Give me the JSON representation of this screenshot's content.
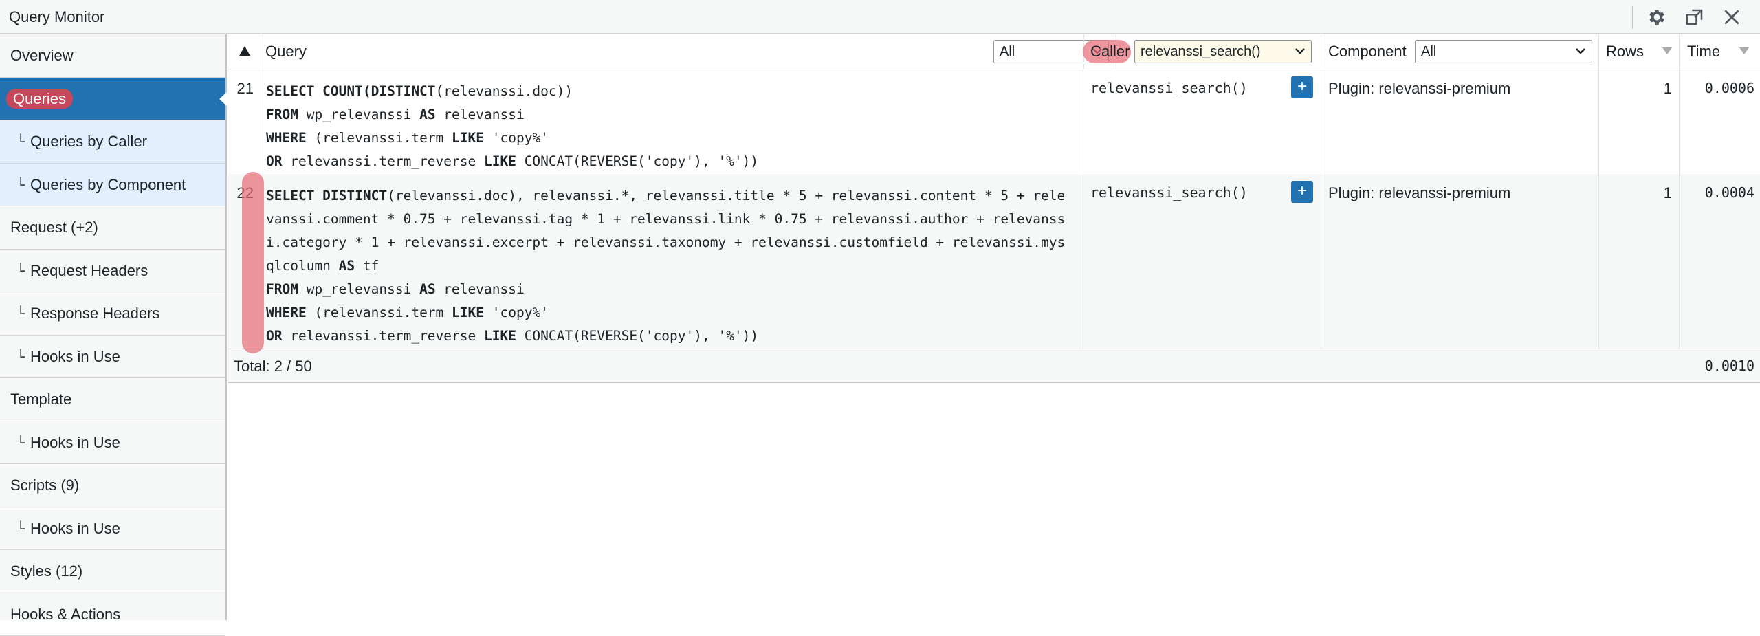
{
  "window": {
    "title": "Query Monitor",
    "icons": [
      "gear-icon",
      "popout-icon",
      "close-icon"
    ]
  },
  "sidebar": {
    "items": [
      {
        "label": "Overview"
      },
      {
        "label": "Queries"
      },
      {
        "label": "Queries by Caller"
      },
      {
        "label": "Queries by Component"
      },
      {
        "label": "Request (+2)"
      },
      {
        "label": "Request Headers"
      },
      {
        "label": "Response Headers"
      },
      {
        "label": "Hooks in Use"
      },
      {
        "label": "Template"
      },
      {
        "label": "Hooks in Use"
      },
      {
        "label": "Scripts (9)"
      },
      {
        "label": "Hooks in Use"
      },
      {
        "label": "Styles (12)"
      },
      {
        "label": "Hooks & Actions"
      }
    ],
    "child_marker": "└"
  },
  "table": {
    "headers": {
      "query": "Query",
      "query_filter": "All",
      "caller": "Caller",
      "caller_filter": "relevanssi_search()",
      "component": "Component",
      "component_filter": "All",
      "rows": "Rows",
      "time": "Time"
    },
    "rows": [
      {
        "num": "21",
        "sql": [
          [
            {
              "k": "SELECT COUNT(DISTINCT"
            },
            {
              "t": "(relevanssi.doc))"
            }
          ],
          [
            {
              "k": "FROM"
            },
            {
              "t": " wp_relevanssi "
            },
            {
              "k": "AS"
            },
            {
              "t": " relevanssi"
            }
          ],
          [
            {
              "k": "WHERE"
            },
            {
              "t": " (relevanssi.term "
            },
            {
              "k": "LIKE"
            },
            {
              "t": " 'copy%'"
            }
          ],
          [
            {
              "k": "OR"
            },
            {
              "t": " relevanssi.term_reverse "
            },
            {
              "k": "LIKE"
            },
            {
              "t": " CONCAT(REVERSE('copy'), '%'))"
            }
          ]
        ],
        "caller": "relevanssi_search()",
        "plus": "+",
        "component": "Plugin: relevanssi-premium",
        "rows": "1",
        "time": "0.0006"
      },
      {
        "num": "22",
        "sql": [
          [
            {
              "k": "SELECT DISTINCT"
            },
            {
              "t": "(relevanssi.doc), relevanssi.*, relevanssi.title * 5 + relevanssi.content * 5 + rele"
            }
          ],
          [
            {
              "t": "vanssi.comment * 0.75 + relevanssi.tag * 1 + relevanssi.link * 0.75 + relevanssi.author + relevanss"
            }
          ],
          [
            {
              "t": "i.category * 1 + relevanssi.excerpt + relevanssi.taxonomy + relevanssi.customfield + relevanssi.mys"
            }
          ],
          [
            {
              "t": "qlcolumn "
            },
            {
              "k": "AS"
            },
            {
              "t": " tf"
            }
          ],
          [
            {
              "k": "FROM"
            },
            {
              "t": " wp_relevanssi "
            },
            {
              "k": "AS"
            },
            {
              "t": " relevanssi"
            }
          ],
          [
            {
              "k": "WHERE"
            },
            {
              "t": " (relevanssi.term "
            },
            {
              "k": "LIKE"
            },
            {
              "t": " 'copy%'"
            }
          ],
          [
            {
              "k": "OR"
            },
            {
              "t": " relevanssi.term_reverse "
            },
            {
              "k": "LIKE"
            },
            {
              "t": " CONCAT(REVERSE('copy'), '%'))"
            }
          ]
        ],
        "caller": "relevanssi_search()",
        "plus": "+",
        "component": "Plugin: relevanssi-premium",
        "rows": "1",
        "time": "0.0004"
      }
    ],
    "footer": {
      "total": "Total: 2 / 50",
      "time_total": "0.0010"
    }
  },
  "colors": {
    "active_nav": "#2271b1",
    "sub_active_nav": "#e1efff",
    "caller_filter_bg": "#fcf9e8",
    "highlight": "#e66e78"
  }
}
